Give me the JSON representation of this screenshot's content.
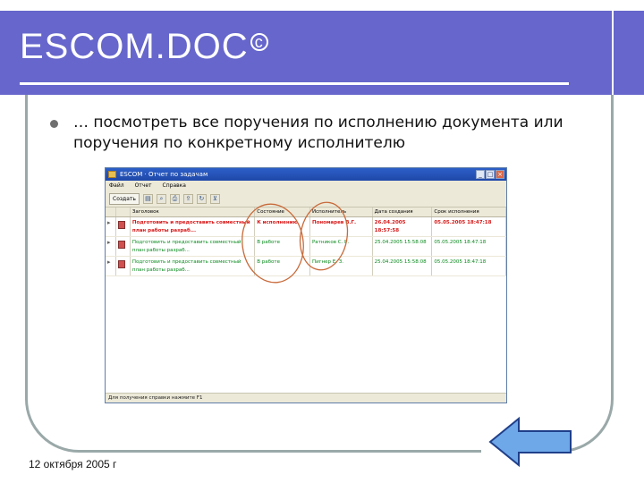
{
  "slide": {
    "title": "ESCOM.DOC",
    "title_mark": "c",
    "bullet": "… посмотреть все поручения по исполнению  документа или поручения по конкретному исполнителю",
    "footer_date": "12 октября 2005 г"
  },
  "window": {
    "title": "ESCOM · Отчет по задачам",
    "menu": [
      "Файл",
      "Отчет",
      "Справка"
    ],
    "toolbar_button": "Создать",
    "toolbar_icons": [
      "open-icon",
      "search-icon",
      "print-icon",
      "export-icon",
      "refresh-icon",
      "filter-icon"
    ],
    "columns": [
      "",
      "",
      "Заголовок",
      "Состояние",
      "Исполнитель",
      "Дата создания",
      "Срок исполнения"
    ],
    "rows": [
      {
        "title": "Подготовить и предоставить совместный план работы разраб...",
        "state": "К исполнению",
        "executor": "Пономарев В.Г.",
        "created": "26.04.2005 18:57:58",
        "due": "05.05.2005 18:47:18",
        "status_color": "red"
      },
      {
        "title": "Подготовить и предоставить совместный план работы разраб...",
        "state": "В работе",
        "executor": "Ратников С. Р.",
        "created": "25.04.2005 15:58:08",
        "due": "05.05.2005 18:47:18",
        "status_color": "green"
      },
      {
        "title": "Подготовить и предоставить совместный план работы разраб...",
        "state": "В работе",
        "executor": "Пигнер Е. З.",
        "created": "25.04.2005 15:58:08",
        "due": "05.05.2005 18:47:18",
        "status_color": "green"
      }
    ],
    "status_bar": "Для получения справки нажмите F1"
  },
  "colors": {
    "title_band": "#6666cc",
    "frame": "#9aa8a8",
    "row_red": "#d81818",
    "row_green": "#0a8a1e",
    "annotation": "#c86a3a",
    "arrow_fill": "#6fa8e8"
  }
}
